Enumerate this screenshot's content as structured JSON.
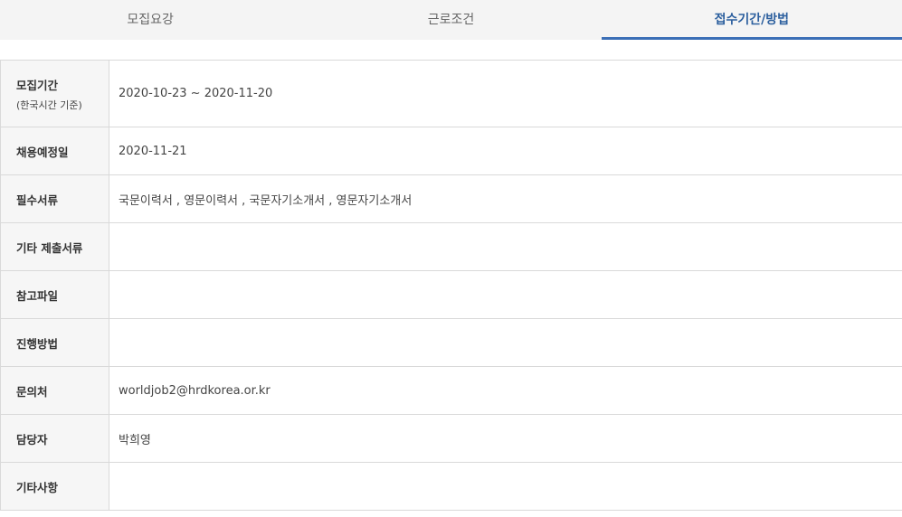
{
  "tabs": [
    {
      "label": "모집요강",
      "active": false
    },
    {
      "label": "근로조건",
      "active": false
    },
    {
      "label": "접수기간/방법",
      "active": true
    }
  ],
  "rows": {
    "period": {
      "label": "모집기간",
      "sublabel": "(한국시간 기준)",
      "value": "2020-10-23 ~ 2020-11-20"
    },
    "hire_date": {
      "label": "채용예정일",
      "value": "2020-11-21"
    },
    "required_docs": {
      "label": "필수서류",
      "value": "국문이력서 , 영문이력서 , 국문자기소개서 , 영문자기소개서"
    },
    "other_docs": {
      "label": "기타 제출서류",
      "value": ""
    },
    "attachments": {
      "label": "참고파일",
      "value": ""
    },
    "method": {
      "label": "진행방법",
      "value": ""
    },
    "contact": {
      "label": "문의처",
      "value": "worldjob2@hrdkorea.or.kr"
    },
    "manager": {
      "label": "담당자",
      "value": "박희영"
    },
    "notes": {
      "label": "기타사항",
      "value": ""
    }
  },
  "colors": {
    "active_tab_text": "#2c5f9e",
    "active_tab_underline": "#3b6fb6",
    "header_bg": "#f6f6f6",
    "tab_bar_bg": "#f4f4f4"
  }
}
